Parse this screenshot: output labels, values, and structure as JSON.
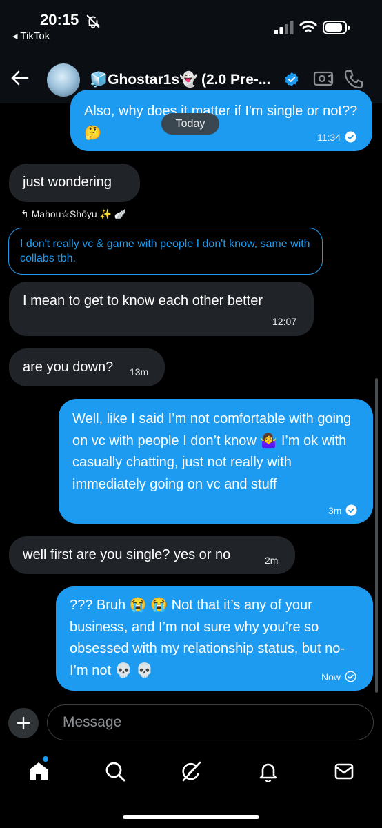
{
  "status_bar": {
    "time": "20:15",
    "back_app": "◂ TikTok"
  },
  "header": {
    "title": "🧊Ghostar1s👻 (2.0 Pre-..."
  },
  "divider": {
    "label": "Today"
  },
  "messages": [
    {
      "text": "Also, why does it matter if I'm single or not?? 🤔",
      "time": "11:34"
    },
    {
      "text": "just wondering"
    },
    {
      "reply_to": "↰ Mahou☆Shōyu ✨ 🪽",
      "quote": "I don't really vc & game with people I don't know, same with collabs tbh.",
      "text": "I mean to get to know each other better",
      "time": "12:07"
    },
    {
      "text": "are you down?",
      "time": "13m"
    },
    {
      "text": "Well, like I said I’m not comfortable with going on vc with people I don’t know 🤷‍♀️ I’m ok with casually chatting, just not really with immediately going on vc and stuff",
      "time": "3m"
    },
    {
      "text": "well first are you single? yes or no",
      "time": "2m"
    },
    {
      "text": "??? Bruh 😭 😭  Not that it’s any of your business, and I’m not sure why you’re so obsessed with my relationship status, but no- I’m not 💀 💀",
      "time": "Now"
    }
  ],
  "composer": {
    "placeholder": "Message"
  },
  "colors": {
    "accent": "#1d9bf0",
    "incoming_bubble": "#202327",
    "background": "#000000"
  },
  "icons": [
    "bell-off-icon",
    "back-arrow-icon",
    "verified-icon",
    "video-call-icon",
    "phone-icon",
    "plus-icon",
    "home-icon",
    "search-icon",
    "grok-icon",
    "notifications-icon",
    "messages-icon"
  ]
}
